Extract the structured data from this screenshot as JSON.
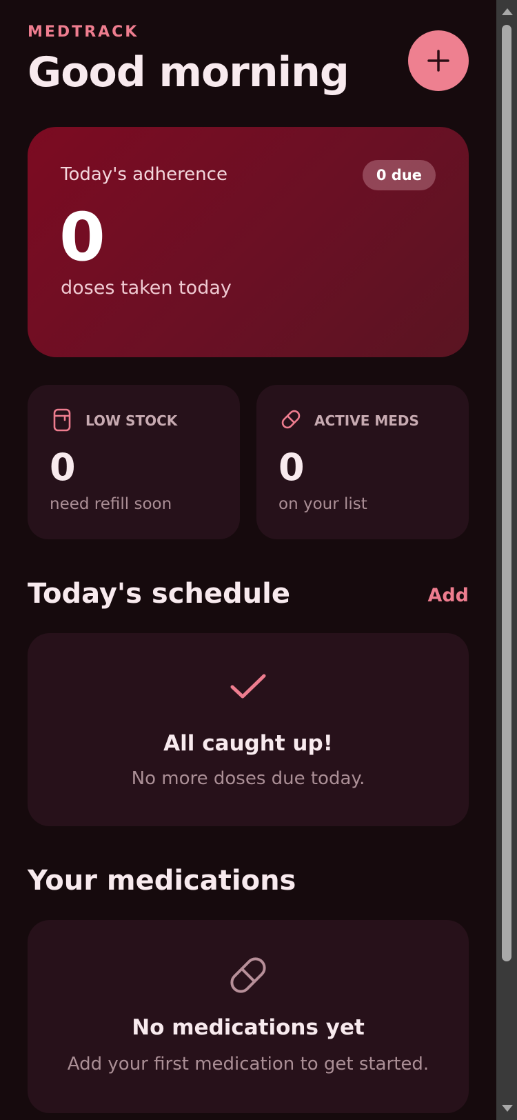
{
  "header": {
    "brand": "MEDTRACK",
    "greeting": "Good morning",
    "add_button_icon": "plus-icon"
  },
  "adherence": {
    "label": "Today's adherence",
    "badge": "0 due",
    "value": "0",
    "sub": "doses taken today"
  },
  "stats": [
    {
      "icon": "pill-bottle-icon",
      "label": "LOW STOCK",
      "value": "0",
      "sub": "need refill soon"
    },
    {
      "icon": "pill-icon",
      "label": "ACTIVE MEDS",
      "value": "0",
      "sub": "on your list"
    }
  ],
  "schedule": {
    "title": "Today's schedule",
    "action": "Add",
    "empty_icon": "check-icon",
    "empty_title": "All caught up!",
    "empty_sub": "No more doses due today."
  },
  "medications": {
    "title": "Your medications",
    "empty_icon": "pill-icon",
    "empty_title": "No medications yet",
    "empty_sub": "Add your first medication to get started."
  },
  "colors": {
    "background": "#160a0d",
    "accent": "#ee7d8f",
    "hero_card": "#7c0b22",
    "card": "#26111a"
  }
}
